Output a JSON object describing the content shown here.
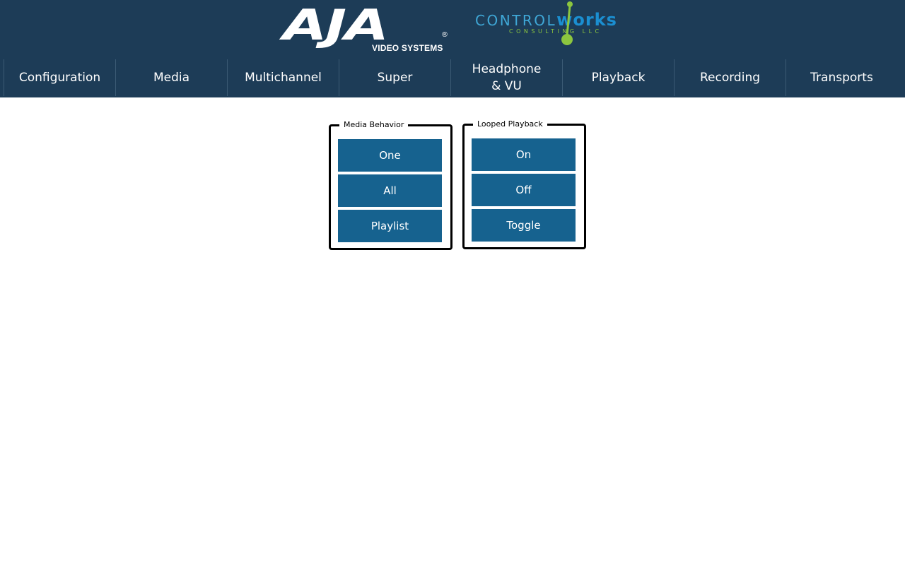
{
  "header": {
    "aja_logo_text": "AJA",
    "aja_logo_registered": "®",
    "aja_logo_subtitle": "VIDEO SYSTEMS",
    "controlworks_logo_text": "CONTROL",
    "controlworks_logo_works": "works",
    "controlworks_logo_subtitle": "CONSULTING LLC",
    "background_color": "#1d3c57"
  },
  "nav": {
    "items": [
      {
        "label": "Configuration"
      },
      {
        "label": "Media"
      },
      {
        "label": "Multichannel"
      },
      {
        "label": "Super"
      },
      {
        "label": "Headphone\n& VU"
      },
      {
        "label": "Playback"
      },
      {
        "label": "Recording"
      },
      {
        "label": "Transports"
      }
    ]
  },
  "groups": {
    "media_behavior": {
      "title": "Media Behavior",
      "buttons": [
        {
          "label": "One"
        },
        {
          "label": "All"
        },
        {
          "label": "Playlist"
        }
      ]
    },
    "looped_playback": {
      "title": "Looped Playback",
      "buttons": [
        {
          "label": "On"
        },
        {
          "label": "Off"
        },
        {
          "label": "Toggle"
        }
      ]
    }
  },
  "colors": {
    "button": "#16628f",
    "header": "#1d3c57",
    "controlworks_blue": "#1b8fd1",
    "controlworks_green": "#8cc63f"
  }
}
